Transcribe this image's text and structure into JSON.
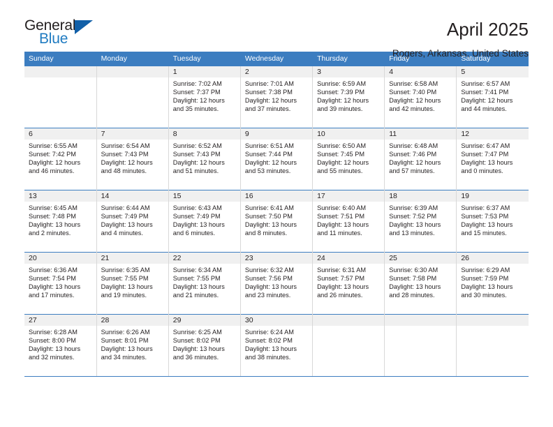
{
  "brand": {
    "name_top": "General",
    "name_bottom": "Blue",
    "triangle_color": "#1260a8",
    "blue_text_color": "#1f7bc1"
  },
  "header": {
    "month_title": "April 2025",
    "location": "Rogers, Arkansas, United States"
  },
  "theme": {
    "header_blue": "#3c7dc0",
    "daynum_band": "#f0f0f0",
    "cell_divider": "#d8d8d8",
    "text": "#231f20"
  },
  "weekday_headers": [
    "Sunday",
    "Monday",
    "Tuesday",
    "Wednesday",
    "Thursday",
    "Friday",
    "Saturday"
  ],
  "labels": {
    "sunrise_prefix": "Sunrise: ",
    "sunset_prefix": "Sunset: ",
    "daylight_prefix": "Daylight: "
  },
  "weeks": [
    [
      {
        "day": "",
        "sunrise": "",
        "sunset": "",
        "daylight_line1": "",
        "daylight_line2": ""
      },
      {
        "day": "",
        "sunrise": "",
        "sunset": "",
        "daylight_line1": "",
        "daylight_line2": ""
      },
      {
        "day": "1",
        "sunrise": "Sunrise: 7:02 AM",
        "sunset": "Sunset: 7:37 PM",
        "daylight_line1": "Daylight: 12 hours",
        "daylight_line2": "and 35 minutes."
      },
      {
        "day": "2",
        "sunrise": "Sunrise: 7:01 AM",
        "sunset": "Sunset: 7:38 PM",
        "daylight_line1": "Daylight: 12 hours",
        "daylight_line2": "and 37 minutes."
      },
      {
        "day": "3",
        "sunrise": "Sunrise: 6:59 AM",
        "sunset": "Sunset: 7:39 PM",
        "daylight_line1": "Daylight: 12 hours",
        "daylight_line2": "and 39 minutes."
      },
      {
        "day": "4",
        "sunrise": "Sunrise: 6:58 AM",
        "sunset": "Sunset: 7:40 PM",
        "daylight_line1": "Daylight: 12 hours",
        "daylight_line2": "and 42 minutes."
      },
      {
        "day": "5",
        "sunrise": "Sunrise: 6:57 AM",
        "sunset": "Sunset: 7:41 PM",
        "daylight_line1": "Daylight: 12 hours",
        "daylight_line2": "and 44 minutes."
      }
    ],
    [
      {
        "day": "6",
        "sunrise": "Sunrise: 6:55 AM",
        "sunset": "Sunset: 7:42 PM",
        "daylight_line1": "Daylight: 12 hours",
        "daylight_line2": "and 46 minutes."
      },
      {
        "day": "7",
        "sunrise": "Sunrise: 6:54 AM",
        "sunset": "Sunset: 7:43 PM",
        "daylight_line1": "Daylight: 12 hours",
        "daylight_line2": "and 48 minutes."
      },
      {
        "day": "8",
        "sunrise": "Sunrise: 6:52 AM",
        "sunset": "Sunset: 7:43 PM",
        "daylight_line1": "Daylight: 12 hours",
        "daylight_line2": "and 51 minutes."
      },
      {
        "day": "9",
        "sunrise": "Sunrise: 6:51 AM",
        "sunset": "Sunset: 7:44 PM",
        "daylight_line1": "Daylight: 12 hours",
        "daylight_line2": "and 53 minutes."
      },
      {
        "day": "10",
        "sunrise": "Sunrise: 6:50 AM",
        "sunset": "Sunset: 7:45 PM",
        "daylight_line1": "Daylight: 12 hours",
        "daylight_line2": "and 55 minutes."
      },
      {
        "day": "11",
        "sunrise": "Sunrise: 6:48 AM",
        "sunset": "Sunset: 7:46 PM",
        "daylight_line1": "Daylight: 12 hours",
        "daylight_line2": "and 57 minutes."
      },
      {
        "day": "12",
        "sunrise": "Sunrise: 6:47 AM",
        "sunset": "Sunset: 7:47 PM",
        "daylight_line1": "Daylight: 13 hours",
        "daylight_line2": "and 0 minutes."
      }
    ],
    [
      {
        "day": "13",
        "sunrise": "Sunrise: 6:45 AM",
        "sunset": "Sunset: 7:48 PM",
        "daylight_line1": "Daylight: 13 hours",
        "daylight_line2": "and 2 minutes."
      },
      {
        "day": "14",
        "sunrise": "Sunrise: 6:44 AM",
        "sunset": "Sunset: 7:49 PM",
        "daylight_line1": "Daylight: 13 hours",
        "daylight_line2": "and 4 minutes."
      },
      {
        "day": "15",
        "sunrise": "Sunrise: 6:43 AM",
        "sunset": "Sunset: 7:49 PM",
        "daylight_line1": "Daylight: 13 hours",
        "daylight_line2": "and 6 minutes."
      },
      {
        "day": "16",
        "sunrise": "Sunrise: 6:41 AM",
        "sunset": "Sunset: 7:50 PM",
        "daylight_line1": "Daylight: 13 hours",
        "daylight_line2": "and 8 minutes."
      },
      {
        "day": "17",
        "sunrise": "Sunrise: 6:40 AM",
        "sunset": "Sunset: 7:51 PM",
        "daylight_line1": "Daylight: 13 hours",
        "daylight_line2": "and 11 minutes."
      },
      {
        "day": "18",
        "sunrise": "Sunrise: 6:39 AM",
        "sunset": "Sunset: 7:52 PM",
        "daylight_line1": "Daylight: 13 hours",
        "daylight_line2": "and 13 minutes."
      },
      {
        "day": "19",
        "sunrise": "Sunrise: 6:37 AM",
        "sunset": "Sunset: 7:53 PM",
        "daylight_line1": "Daylight: 13 hours",
        "daylight_line2": "and 15 minutes."
      }
    ],
    [
      {
        "day": "20",
        "sunrise": "Sunrise: 6:36 AM",
        "sunset": "Sunset: 7:54 PM",
        "daylight_line1": "Daylight: 13 hours",
        "daylight_line2": "and 17 minutes."
      },
      {
        "day": "21",
        "sunrise": "Sunrise: 6:35 AM",
        "sunset": "Sunset: 7:55 PM",
        "daylight_line1": "Daylight: 13 hours",
        "daylight_line2": "and 19 minutes."
      },
      {
        "day": "22",
        "sunrise": "Sunrise: 6:34 AM",
        "sunset": "Sunset: 7:55 PM",
        "daylight_line1": "Daylight: 13 hours",
        "daylight_line2": "and 21 minutes."
      },
      {
        "day": "23",
        "sunrise": "Sunrise: 6:32 AM",
        "sunset": "Sunset: 7:56 PM",
        "daylight_line1": "Daylight: 13 hours",
        "daylight_line2": "and 23 minutes."
      },
      {
        "day": "24",
        "sunrise": "Sunrise: 6:31 AM",
        "sunset": "Sunset: 7:57 PM",
        "daylight_line1": "Daylight: 13 hours",
        "daylight_line2": "and 26 minutes."
      },
      {
        "day": "25",
        "sunrise": "Sunrise: 6:30 AM",
        "sunset": "Sunset: 7:58 PM",
        "daylight_line1": "Daylight: 13 hours",
        "daylight_line2": "and 28 minutes."
      },
      {
        "day": "26",
        "sunrise": "Sunrise: 6:29 AM",
        "sunset": "Sunset: 7:59 PM",
        "daylight_line1": "Daylight: 13 hours",
        "daylight_line2": "and 30 minutes."
      }
    ],
    [
      {
        "day": "27",
        "sunrise": "Sunrise: 6:28 AM",
        "sunset": "Sunset: 8:00 PM",
        "daylight_line1": "Daylight: 13 hours",
        "daylight_line2": "and 32 minutes."
      },
      {
        "day": "28",
        "sunrise": "Sunrise: 6:26 AM",
        "sunset": "Sunset: 8:01 PM",
        "daylight_line1": "Daylight: 13 hours",
        "daylight_line2": "and 34 minutes."
      },
      {
        "day": "29",
        "sunrise": "Sunrise: 6:25 AM",
        "sunset": "Sunset: 8:02 PM",
        "daylight_line1": "Daylight: 13 hours",
        "daylight_line2": "and 36 minutes."
      },
      {
        "day": "30",
        "sunrise": "Sunrise: 6:24 AM",
        "sunset": "Sunset: 8:02 PM",
        "daylight_line1": "Daylight: 13 hours",
        "daylight_line2": "and 38 minutes."
      },
      {
        "day": "",
        "sunrise": "",
        "sunset": "",
        "daylight_line1": "",
        "daylight_line2": ""
      },
      {
        "day": "",
        "sunrise": "",
        "sunset": "",
        "daylight_line1": "",
        "daylight_line2": ""
      },
      {
        "day": "",
        "sunrise": "",
        "sunset": "",
        "daylight_line1": "",
        "daylight_line2": ""
      }
    ]
  ]
}
